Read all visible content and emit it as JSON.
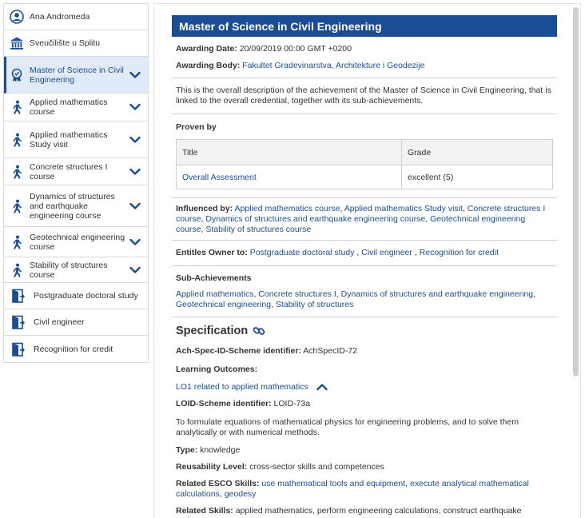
{
  "sidebar": {
    "items": [
      {
        "label": "Ana Andromeda",
        "icon": "user-icon"
      },
      {
        "label": "Sveučilište u Splitu",
        "icon": "institution-icon"
      },
      {
        "label": "Master of Science in Civil Engineering",
        "icon": "award-icon"
      },
      {
        "label": "Applied mathematics course",
        "icon": "walking-person-icon"
      },
      {
        "label": "Applied mathematics Study visit",
        "icon": "walking-person-icon"
      },
      {
        "label": "Concrete structures I course",
        "icon": "walking-person-icon"
      },
      {
        "label": "Dynamics of structures and earthquake engineering course",
        "icon": "walking-person-icon"
      },
      {
        "label": "Geotechnical engineering course",
        "icon": "walking-person-icon"
      },
      {
        "label": "Stability of structures course",
        "icon": "walking-person-icon"
      },
      {
        "label": "Postgraduate doctoral study",
        "icon": "door-exit-icon"
      },
      {
        "label": "Civil engineer",
        "icon": "door-exit-icon"
      },
      {
        "label": "Recognition for credit",
        "icon": "door-exit-icon"
      }
    ]
  },
  "main": {
    "title": "Master of Science in Civil Engineering",
    "awarding_date_label": "Awarding Date:",
    "awarding_date_value": "20/09/2019 00:00 GMT +0200",
    "awarding_body_label": "Awarding Body:",
    "awarding_body_value": "Fakultet Gradevinarstva, Architekture i Geodezije",
    "description": "This is the overall description of the achievement of the Master of Science in Civil Engineering, that is linked to the overall credential, together with its sub-achievements.",
    "proven_by_label": "Proven by",
    "proven_table": {
      "headers": [
        "Title",
        "Grade"
      ],
      "rows": [
        [
          "Overall Assessment",
          "excellent (5)"
        ]
      ]
    },
    "influenced_by_label": "Influenced by:",
    "influenced_by": [
      "Applied mathematics course",
      "Applied mathematics Study visit",
      "Concrete structures I course",
      "Dynamics of structures and earthquake engineering course",
      "Geotechnical engineering course",
      "Stability of structures course"
    ],
    "entitles_label": "Entitles Owner to:",
    "entitles": [
      "Postgraduate doctoral study",
      "Civil engineer",
      "Recognition for credit"
    ],
    "sub_achievements_label": "Sub-Achievements",
    "sub_achievements": [
      "Applied mathematics",
      "Concrete structures I",
      "Dynamics of structures and earthquake engineering",
      "Geotechnical engineering",
      "Stability of structures"
    ],
    "specification": {
      "title": "Specification",
      "scheme_label": "Ach-Spec-ID-Scheme identifier:",
      "scheme_value": "AchSpecID-72",
      "learning_outcomes_label": "Learning Outcomes:",
      "lo_title": "LO1 related to applied mathematics",
      "loid_label": "LOID-Scheme identifier:",
      "loid_value": "LOID-73a",
      "lo_description": "To formulate equations of mathematical physics for engineering problems, and to solve them analytically or with numerical methods.",
      "type_label": "Type:",
      "type_value": "knowledge",
      "reusability_label": "Reusability Level:",
      "reusability_value": "cross-sector skills and competences",
      "esco_label": "Related ESCO Skills:",
      "esco_skills": [
        "use mathematical tools and equipment",
        "execute analytical mathematical calculations",
        "geodesy"
      ],
      "related_label": "Related Skills:",
      "related_value": "applied mathematics, perform engineering calculations, construct earthquake resistant structures"
    }
  },
  "colors": {
    "accent": "#1a4d96",
    "active_bg": "#e1ebf8"
  }
}
